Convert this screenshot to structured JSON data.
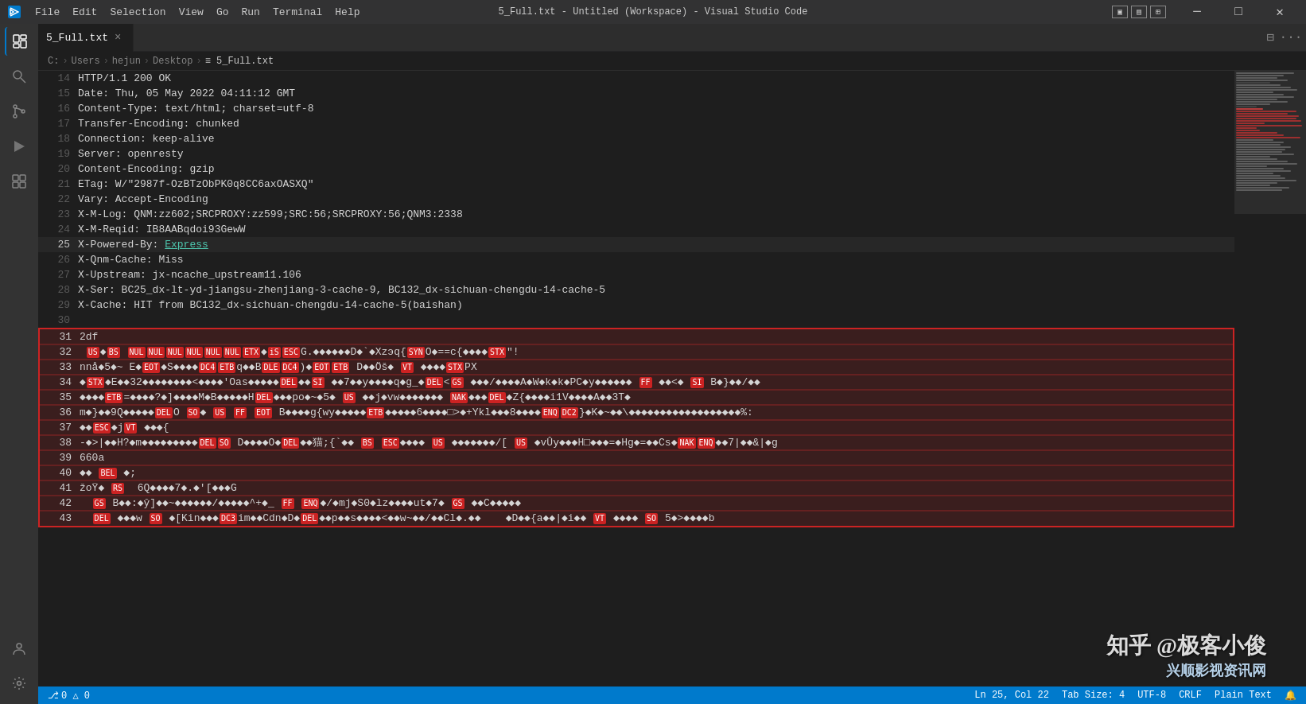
{
  "titlebar": {
    "app_name": "5_Full.txt - Untitled (Workspace) - Visual Studio Code",
    "file_name": "5_Full.txt",
    "menu_items": [
      "File",
      "Edit",
      "Selection",
      "View",
      "Go",
      "Run",
      "Terminal",
      "Help"
    ]
  },
  "breadcrumb": {
    "parts": [
      "C:",
      "Users",
      "hejun",
      "Desktop",
      "5_Full.txt"
    ]
  },
  "tab": {
    "name": "5_Full.txt",
    "close_label": "×"
  },
  "lines": [
    {
      "n": 14,
      "text": "HTTP/1.1 200 OK",
      "sel": false
    },
    {
      "n": 15,
      "text": "Date: Thu, 05 May 2022 04:11:12 GMT",
      "sel": false
    },
    {
      "n": 16,
      "text": "Content-Type: text/html; charset=utf-8",
      "sel": false
    },
    {
      "n": 17,
      "text": "Transfer-Encoding: chunked",
      "sel": false
    },
    {
      "n": 18,
      "text": "Connection: keep-alive",
      "sel": false
    },
    {
      "n": 19,
      "text": "Server: openresty",
      "sel": false
    },
    {
      "n": 20,
      "text": "Content-Encoding: gzip",
      "sel": false
    },
    {
      "n": 21,
      "text": "ETag: W/\"2987f-OzBTzObPK0q8CC6axOASXQ\"",
      "sel": false
    },
    {
      "n": 22,
      "text": "Vary: Accept-Encoding",
      "sel": false
    },
    {
      "n": 23,
      "text": "X-M-Log: QNM:zz602;SRCPROXY:zz599;SRC:56;SRCPROXY:56;QNM3:2338",
      "sel": false
    },
    {
      "n": 24,
      "text": "X-M-Reqid: IB8AABqdoi93GewW",
      "sel": false
    },
    {
      "n": 25,
      "text": "X-Powered-By: Express",
      "sel": false,
      "link": "Express"
    },
    {
      "n": 26,
      "text": "X-Qnm-Cache: Miss",
      "sel": false
    },
    {
      "n": 27,
      "text": "X-Upstream: jx-ncache_upstream11.106",
      "sel": false
    },
    {
      "n": 28,
      "text": "X-Ser: BC25_dx-lt-yd-jiangsu-zhenjiang-3-cache-9, BC132_dx-sichuan-chengdu-14-cache-5",
      "sel": false
    },
    {
      "n": 29,
      "text": "X-Cache: HIT from BC132_dx-sichuan-chengdu-14-cache-5(baishan)",
      "sel": false
    },
    {
      "n": 30,
      "text": "",
      "sel": false
    },
    {
      "n": 31,
      "text": "2df",
      "sel": true
    },
    {
      "n": 32,
      "text": "  US ◆ BS NULNULNULNULNULNULETX◆iSescG.◆◆◆◆◆◆D◆`◆Xzэq{synO◆==c{◆◆◆◆STX\"!",
      "sel": true,
      "binary": true
    },
    {
      "n": 33,
      "text": "nnå◆5◆~ E◆eot◆S◆◆◆◆DC4ETBq◆◆BdleDC4)◆eoteTB D◆◆Öš◆ VT ◆◆◆◆STXPX",
      "sel": true,
      "binary": true
    },
    {
      "n": 34,
      "text": "◆STX◆E◆◆32◆◆◆◆◆◆◆◆<◆◆◆◆'O∂s◆◆◆◆◆DEL◆◆SI ◆◆7◆◆y◆◆◆◆q◆g_◆DEL<GS ◆◆◆/◆◆◆◆A◆W◆k◆k◆PC◆y◆◆◆◆◆◆ FF ◆◆<◆ SI B◆}◆◆/◆◆",
      "sel": true,
      "binary": true
    },
    {
      "n": 35,
      "text": "◆◆◆◆ETB=◆◆◆◆?◆]◆◆◆◆M◆B◆◆◆◆◆Hdel◆◆◆po◆~◆5◆ US ◆◆j◆vw◆◆◆◆◆◆◆ NAK◆◆◆DEL◆Z{◆◆◆◆i1V◆◆◆◆A◆◆3T◆",
      "sel": true,
      "binary": true
    },
    {
      "n": 36,
      "text": "m◆}◆◆9Q◆◆◆◆◆DELO so◆ US FF EOT B◆◆◆◆g{wy◆◆◆◆◆ETB◆◆◆◆◆6◆◆◆◆□>◆+Ykl◆◆◆8◆◆◆◆ENQDC2}◆K◆~◆◆\\◆◆◆◆◆◆◆◆◆◆◆◆◆◆◆◆◆◆%:",
      "sel": true,
      "binary": true
    },
    {
      "n": 37,
      "text": "◆◆ESC◆jvT ◆◆◆{",
      "sel": true,
      "binary": true
    },
    {
      "n": 38,
      "text": "-◆>|◆◆H?◆m◆◆◆◆◆◆◆◆◆DELSO D◆◆◆◆O◆DEL◆◆猫;{`◆◆ BS ESC◆◆◆◆ US ◆◆◆◆◆◆◆/[ US ◆vÛy◆◆◆H□◆◆◆=◆Hg◆=◆◆Cs◆NAKENQ◆◆7|◆◆&|◆g",
      "sel": true,
      "binary": true
    },
    {
      "n": 39,
      "text": "660a",
      "sel": true
    },
    {
      "n": 40,
      "text": "◆◆ BEL ◆;",
      "sel": true,
      "binary": true
    },
    {
      "n": 41,
      "text": "žoŸ◆ RS  6Q◆◆◆◆7◆.◆'[◆◆◆G",
      "sel": true,
      "binary": true
    },
    {
      "n": 42,
      "text": "  GS B◆◆:◆ŷ]◆◆~◆◆◆◆◆◆/◆◆◆◆◆^+◆_ FF ENQ◆/◆mj◆S0◆lz◆◆◆◆ut◆7◆ GS ◆◆C◆◆◆◆◆",
      "sel": true,
      "binary": true
    },
    {
      "n": 43,
      "text": "  DEL ◆◆◆w SO ◆[Kin◆◆◆DC3im◆◆Cdn◆D◆DEL◆◆p◆◆s◆◆◆◆<◆◆w~◆◆/◆◆Cl◆.◆◆    ◆D◆◆{a◆◆|◆i◆◆ VT ◆◆◆◆ SO 5◆>◆◆◆◆b",
      "sel": true,
      "binary": true
    }
  ],
  "status_bar": {
    "git": "0 △ 0",
    "position": "Ln 25, Col 22",
    "spaces": "Tab Size: 4",
    "encoding": "UTF-8",
    "eol": "CRLF",
    "language": "Plain Text"
  },
  "watermark": {
    "line1": "知乎 @极客小俊",
    "line2": "兴顺影视资讯网"
  }
}
